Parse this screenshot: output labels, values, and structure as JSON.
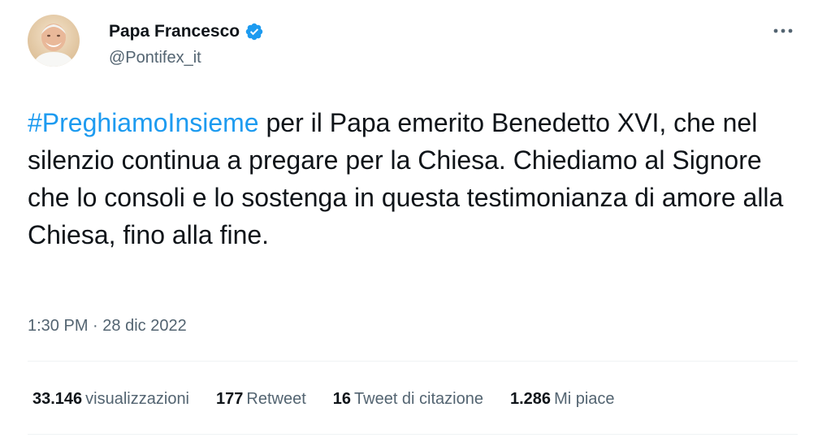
{
  "author": {
    "display_name": "Papa Francesco",
    "handle": "@Pontifex_it",
    "verified": true,
    "avatar_icon": "portrait-avatar"
  },
  "more_icon": "more-dots-icon",
  "tweet": {
    "hashtag": "#PreghiamoInsieme",
    "text": " per il Papa emerito Benedetto XVI, che nel silenzio continua a pregare per la Chiesa. Chiediamo al Signore che lo consoli e lo sostenga in questa testimonianza di amore alla Chiesa, fino alla fine."
  },
  "timestamp": {
    "time": "1:30 PM",
    "separator": "·",
    "date": "28 dic 2022"
  },
  "stats": [
    {
      "value": "33.146",
      "label": "visualizzazioni"
    },
    {
      "value": "177",
      "label": "Retweet"
    },
    {
      "value": "16",
      "label": "Tweet di citazione"
    },
    {
      "value": "1.286",
      "label": "Mi piace"
    }
  ],
  "colors": {
    "accent": "#1d9bf0",
    "text": "#0f1419",
    "secondary": "#536471",
    "divider": "#eff3f4"
  }
}
